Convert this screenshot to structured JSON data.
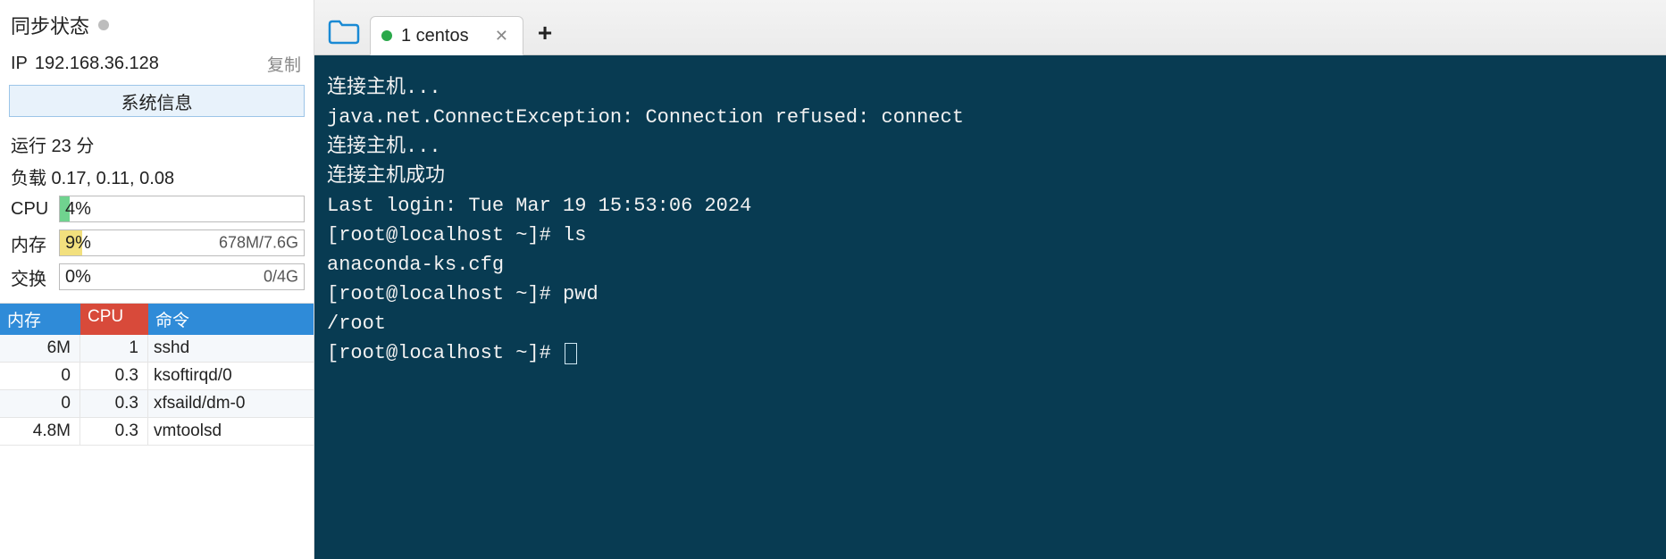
{
  "sidebar": {
    "sync_status_label": "同步状态",
    "ip_label": "IP",
    "ip_value": "192.168.36.128",
    "copy_label": "复制",
    "sysinfo_button": "系统信息",
    "uptime_text": "运行 23 分",
    "load_text": "负载 0.17, 0.11, 0.08",
    "cpu": {
      "label": "CPU",
      "pct_text": "4%",
      "pct": 4
    },
    "mem": {
      "label": "内存",
      "pct_text": "9%",
      "pct": 9,
      "right": "678M/7.6G"
    },
    "swap": {
      "label": "交换",
      "pct_text": "0%",
      "pct": 0,
      "right": "0/4G"
    },
    "proc_headers": {
      "mem": "内存",
      "cpu": "CPU",
      "cmd": "命令"
    },
    "processes": [
      {
        "mem": "6M",
        "cpu": "1",
        "cmd": "sshd"
      },
      {
        "mem": "0",
        "cpu": "0.3",
        "cmd": "ksoftirqd/0"
      },
      {
        "mem": "0",
        "cpu": "0.3",
        "cmd": "xfsaild/dm-0"
      },
      {
        "mem": "4.8M",
        "cpu": "0.3",
        "cmd": "vmtoolsd"
      }
    ]
  },
  "tabs": {
    "active": {
      "label": "1 centos"
    }
  },
  "terminal": {
    "lines": [
      "连接主机...",
      "java.net.ConnectException: Connection refused: connect",
      "连接主机...",
      "连接主机成功",
      "Last login: Tue Mar 19 15:53:06 2024",
      "[root@localhost ~]# ls",
      "anaconda-ks.cfg",
      "[root@localhost ~]# pwd",
      "/root",
      "[root@localhost ~]# "
    ]
  }
}
